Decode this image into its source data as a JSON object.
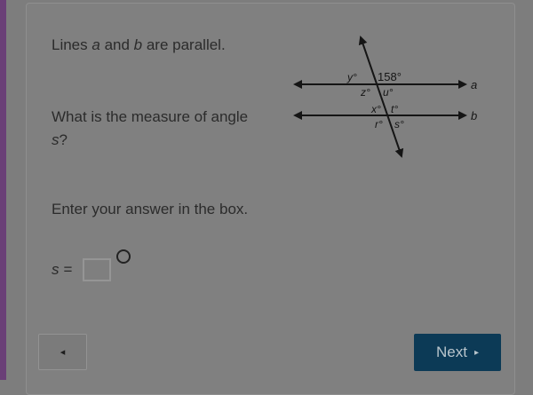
{
  "question": {
    "line1": {
      "prefix": "Lines ",
      "var_a": "a",
      "and": " and ",
      "var_b": "b",
      "suffix": " are parallel."
    },
    "line2": {
      "text": "What is the measure of angle ",
      "var_s": "s",
      "q": "?"
    },
    "line3": "Enter your answer in the box."
  },
  "diagram": {
    "angle_given": "158°",
    "labels": {
      "y": "y°",
      "z": "z°",
      "u": "u°",
      "x": "x°",
      "t": "t°",
      "r": "r°",
      "s": "s°",
      "line_a": "a",
      "line_b": "b"
    }
  },
  "answer": {
    "label": "s =",
    "value": "",
    "unit_symbol": "degree"
  },
  "nav": {
    "back_icon": "◂",
    "next_label": "Next",
    "next_icon": "▸"
  },
  "colors": {
    "background": "#7d7d7d",
    "accent": "#6a3f77",
    "next_button": "#0c3a56"
  }
}
